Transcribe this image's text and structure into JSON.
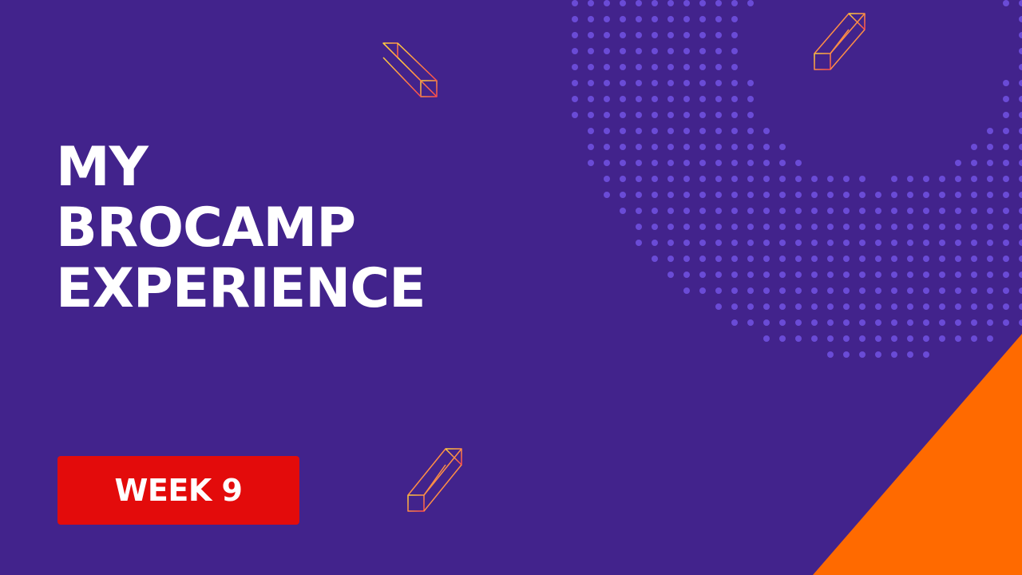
{
  "slide": {
    "title_lines": [
      "MY",
      "BROCAMP",
      "EXPERIENCE"
    ],
    "badge_label": "WEEK 9"
  },
  "colors": {
    "background": "#42238c",
    "dots": "#6a4bd6",
    "accent_orange": "#ff6a00",
    "badge_red": "#e30b0b",
    "text": "#ffffff",
    "outline_gradient_start": "#ffd23f",
    "outline_gradient_end": "#ff4a4a"
  },
  "decor": {
    "dot_pattern": "dotted-arc",
    "corner_shape": "orange-diagonal-stripe",
    "outline_prisms": 3
  }
}
